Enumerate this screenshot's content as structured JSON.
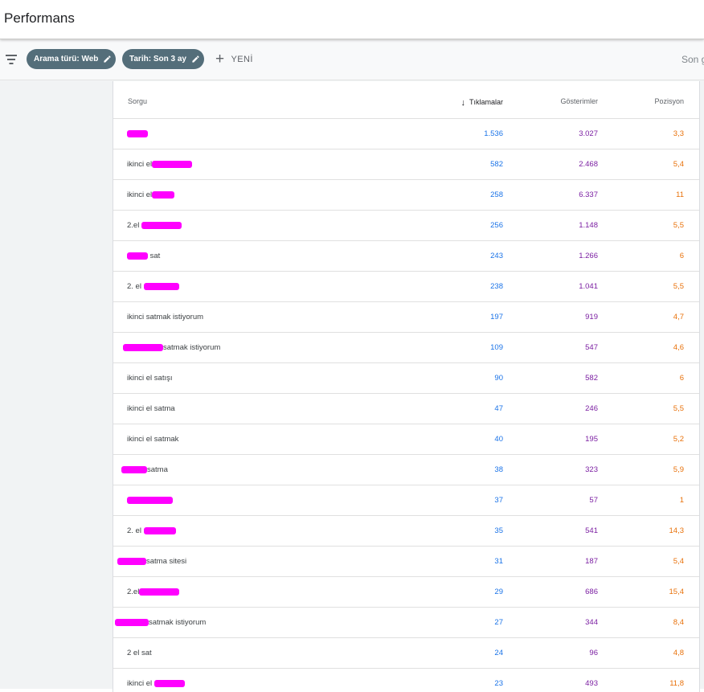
{
  "header": {
    "title": "Performans"
  },
  "filters": {
    "chip_search_type": "Arama türü: Web",
    "chip_date": "Tarih: Son 3 ay",
    "new_label": "YENİ",
    "right_label": "Son g"
  },
  "table": {
    "columns": {
      "query": "Sorgu",
      "clicks": "Tıklamalar",
      "impressions": "Gösterimler",
      "position": "Pozisyon"
    },
    "rows": [
      {
        "query": "",
        "clicks": "1.536",
        "impressions": "3.027",
        "position": "3,3"
      },
      {
        "query": "ikinci el",
        "clicks": "582",
        "impressions": "2.468",
        "position": "5,4"
      },
      {
        "query": "ikinci el",
        "clicks": "258",
        "impressions": "6.337",
        "position": "11"
      },
      {
        "query": "2.el",
        "clicks": "256",
        "impressions": "1.148",
        "position": "5,5"
      },
      {
        "query": "sat",
        "clicks": "243",
        "impressions": "1.266",
        "position": "6"
      },
      {
        "query": "2. el",
        "clicks": "238",
        "impressions": "1.041",
        "position": "5,5"
      },
      {
        "query": "ikinci satmak istiyorum",
        "clicks": "197",
        "impressions": "919",
        "position": "4,7"
      },
      {
        "query": "satmak istiyorum",
        "clicks": "109",
        "impressions": "547",
        "position": "4,6"
      },
      {
        "query": "ikinci el satışı",
        "clicks": "90",
        "impressions": "582",
        "position": "6"
      },
      {
        "query": "ikinci el satma",
        "clicks": "47",
        "impressions": "246",
        "position": "5,5"
      },
      {
        "query": "ikinci el satmak",
        "clicks": "40",
        "impressions": "195",
        "position": "5,2"
      },
      {
        "query": "satma",
        "clicks": "38",
        "impressions": "323",
        "position": "5,9"
      },
      {
        "query": "",
        "clicks": "37",
        "impressions": "57",
        "position": "1"
      },
      {
        "query": "2. el",
        "clicks": "35",
        "impressions": "541",
        "position": "14,3"
      },
      {
        "query": "satma sitesi",
        "clicks": "31",
        "impressions": "187",
        "position": "5,4"
      },
      {
        "query": "2.el",
        "clicks": "29",
        "impressions": "686",
        "position": "15,4"
      },
      {
        "query": "satmak istiyorum",
        "clicks": "27",
        "impressions": "344",
        "position": "8,4"
      },
      {
        "query": "2 el sat",
        "clicks": "24",
        "impressions": "96",
        "position": "4,8"
      },
      {
        "query": "ikinci el",
        "clicks": "23",
        "impressions": "493",
        "position": "11,8"
      }
    ]
  },
  "colors": {
    "clicks": "#1a73e8",
    "impressions": "#7b1fa2",
    "position": "#e8710a",
    "chip": "#546e7a",
    "redaction": "#ff00ff"
  }
}
